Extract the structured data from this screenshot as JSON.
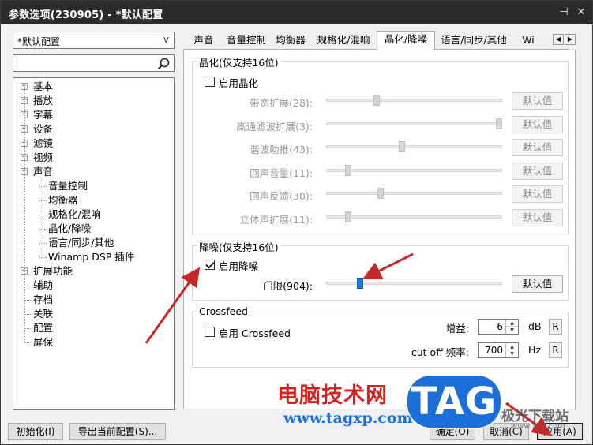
{
  "window": {
    "title": "参数选项(230905) - *默认配置",
    "pin_glyph": "⊣",
    "close_glyph": "✕"
  },
  "sidebar": {
    "profile": "*默认配置",
    "profile_caret": "v",
    "search_placeholder": "",
    "tree": [
      {
        "label": "基本",
        "expander": "+"
      },
      {
        "label": "播放",
        "expander": "+"
      },
      {
        "label": "字幕",
        "expander": "+"
      },
      {
        "label": "设备",
        "expander": "+"
      },
      {
        "label": "滤镜",
        "expander": "+"
      },
      {
        "label": "视频",
        "expander": "+"
      },
      {
        "label": "声音",
        "expander": "−"
      },
      {
        "label": "音量控制",
        "child": true
      },
      {
        "label": "均衡器",
        "child": true
      },
      {
        "label": "规格化/混响",
        "child": true
      },
      {
        "label": "晶化/降噪",
        "child": true,
        "selected": true
      },
      {
        "label": "语言/同步/其他",
        "child": true
      },
      {
        "label": "Winamp DSP 插件",
        "child": true
      },
      {
        "label": "扩展功能",
        "expander": "+"
      },
      {
        "label": "辅助"
      },
      {
        "label": "存档"
      },
      {
        "label": "关联"
      },
      {
        "label": "配置"
      },
      {
        "label": "屏保"
      }
    ]
  },
  "tabs": [
    {
      "label": "声音"
    },
    {
      "label": "音量控制"
    },
    {
      "label": "均衡器"
    },
    {
      "label": "规格化/混响"
    },
    {
      "label": "晶化/降噪",
      "active": true
    },
    {
      "label": "语言/同步/其他"
    },
    {
      "label": "Wi"
    }
  ],
  "tab_scroll": {
    "left": "◀",
    "right": "▶"
  },
  "crystal": {
    "title": "晶化(仅支持16位)",
    "enable_label": "启用晶化",
    "enabled": false,
    "sliders": [
      {
        "label": "带宽扩展(28):",
        "value": 28,
        "pos": 0.28
      },
      {
        "label": "高通滤波扩展(3):",
        "value": 3,
        "pos": 1.0
      },
      {
        "label": "谐波助推(43):",
        "value": 43,
        "pos": 0.43
      },
      {
        "label": "回声音量(11):",
        "value": 11,
        "pos": 0.11
      },
      {
        "label": "回声反馈(30):",
        "value": 30,
        "pos": 0.3
      },
      {
        "label": "立体声扩展(11):",
        "value": 11,
        "pos": 0.11
      }
    ]
  },
  "denoise": {
    "title": "降噪(仅支持16位)",
    "enable_label": "启用降噪",
    "enabled": true,
    "threshold_label": "门限(904):",
    "threshold_value": 904,
    "threshold_pos": 0.18
  },
  "crossfeed": {
    "title": "Crossfeed",
    "enable_label": "启用 Crossfeed",
    "enabled": false,
    "gain_label": "增益:",
    "gain_value": "6",
    "gain_unit": "dB",
    "cutoff_label": "cut off 频率:",
    "cutoff_value": "700",
    "cutoff_unit": "Hz",
    "reset_label": "R"
  },
  "buttons": {
    "default_label": "默认值",
    "init": "初始化(I)",
    "export": "导出当前配置(S)...",
    "ok": "确定(O)",
    "cancel": "取消(C)",
    "apply": "应用(A)"
  },
  "watermark": {
    "site_name": "电脑技术网",
    "site_url": "www.tagxp.com",
    "logo": "TAG",
    "dl_name": "极光下载站",
    "dl_url": "www.xz7.com"
  },
  "colors": {
    "arrow": "#c62828",
    "slider_active": "#1e78d6",
    "titlebar": "#2b2b2b"
  }
}
